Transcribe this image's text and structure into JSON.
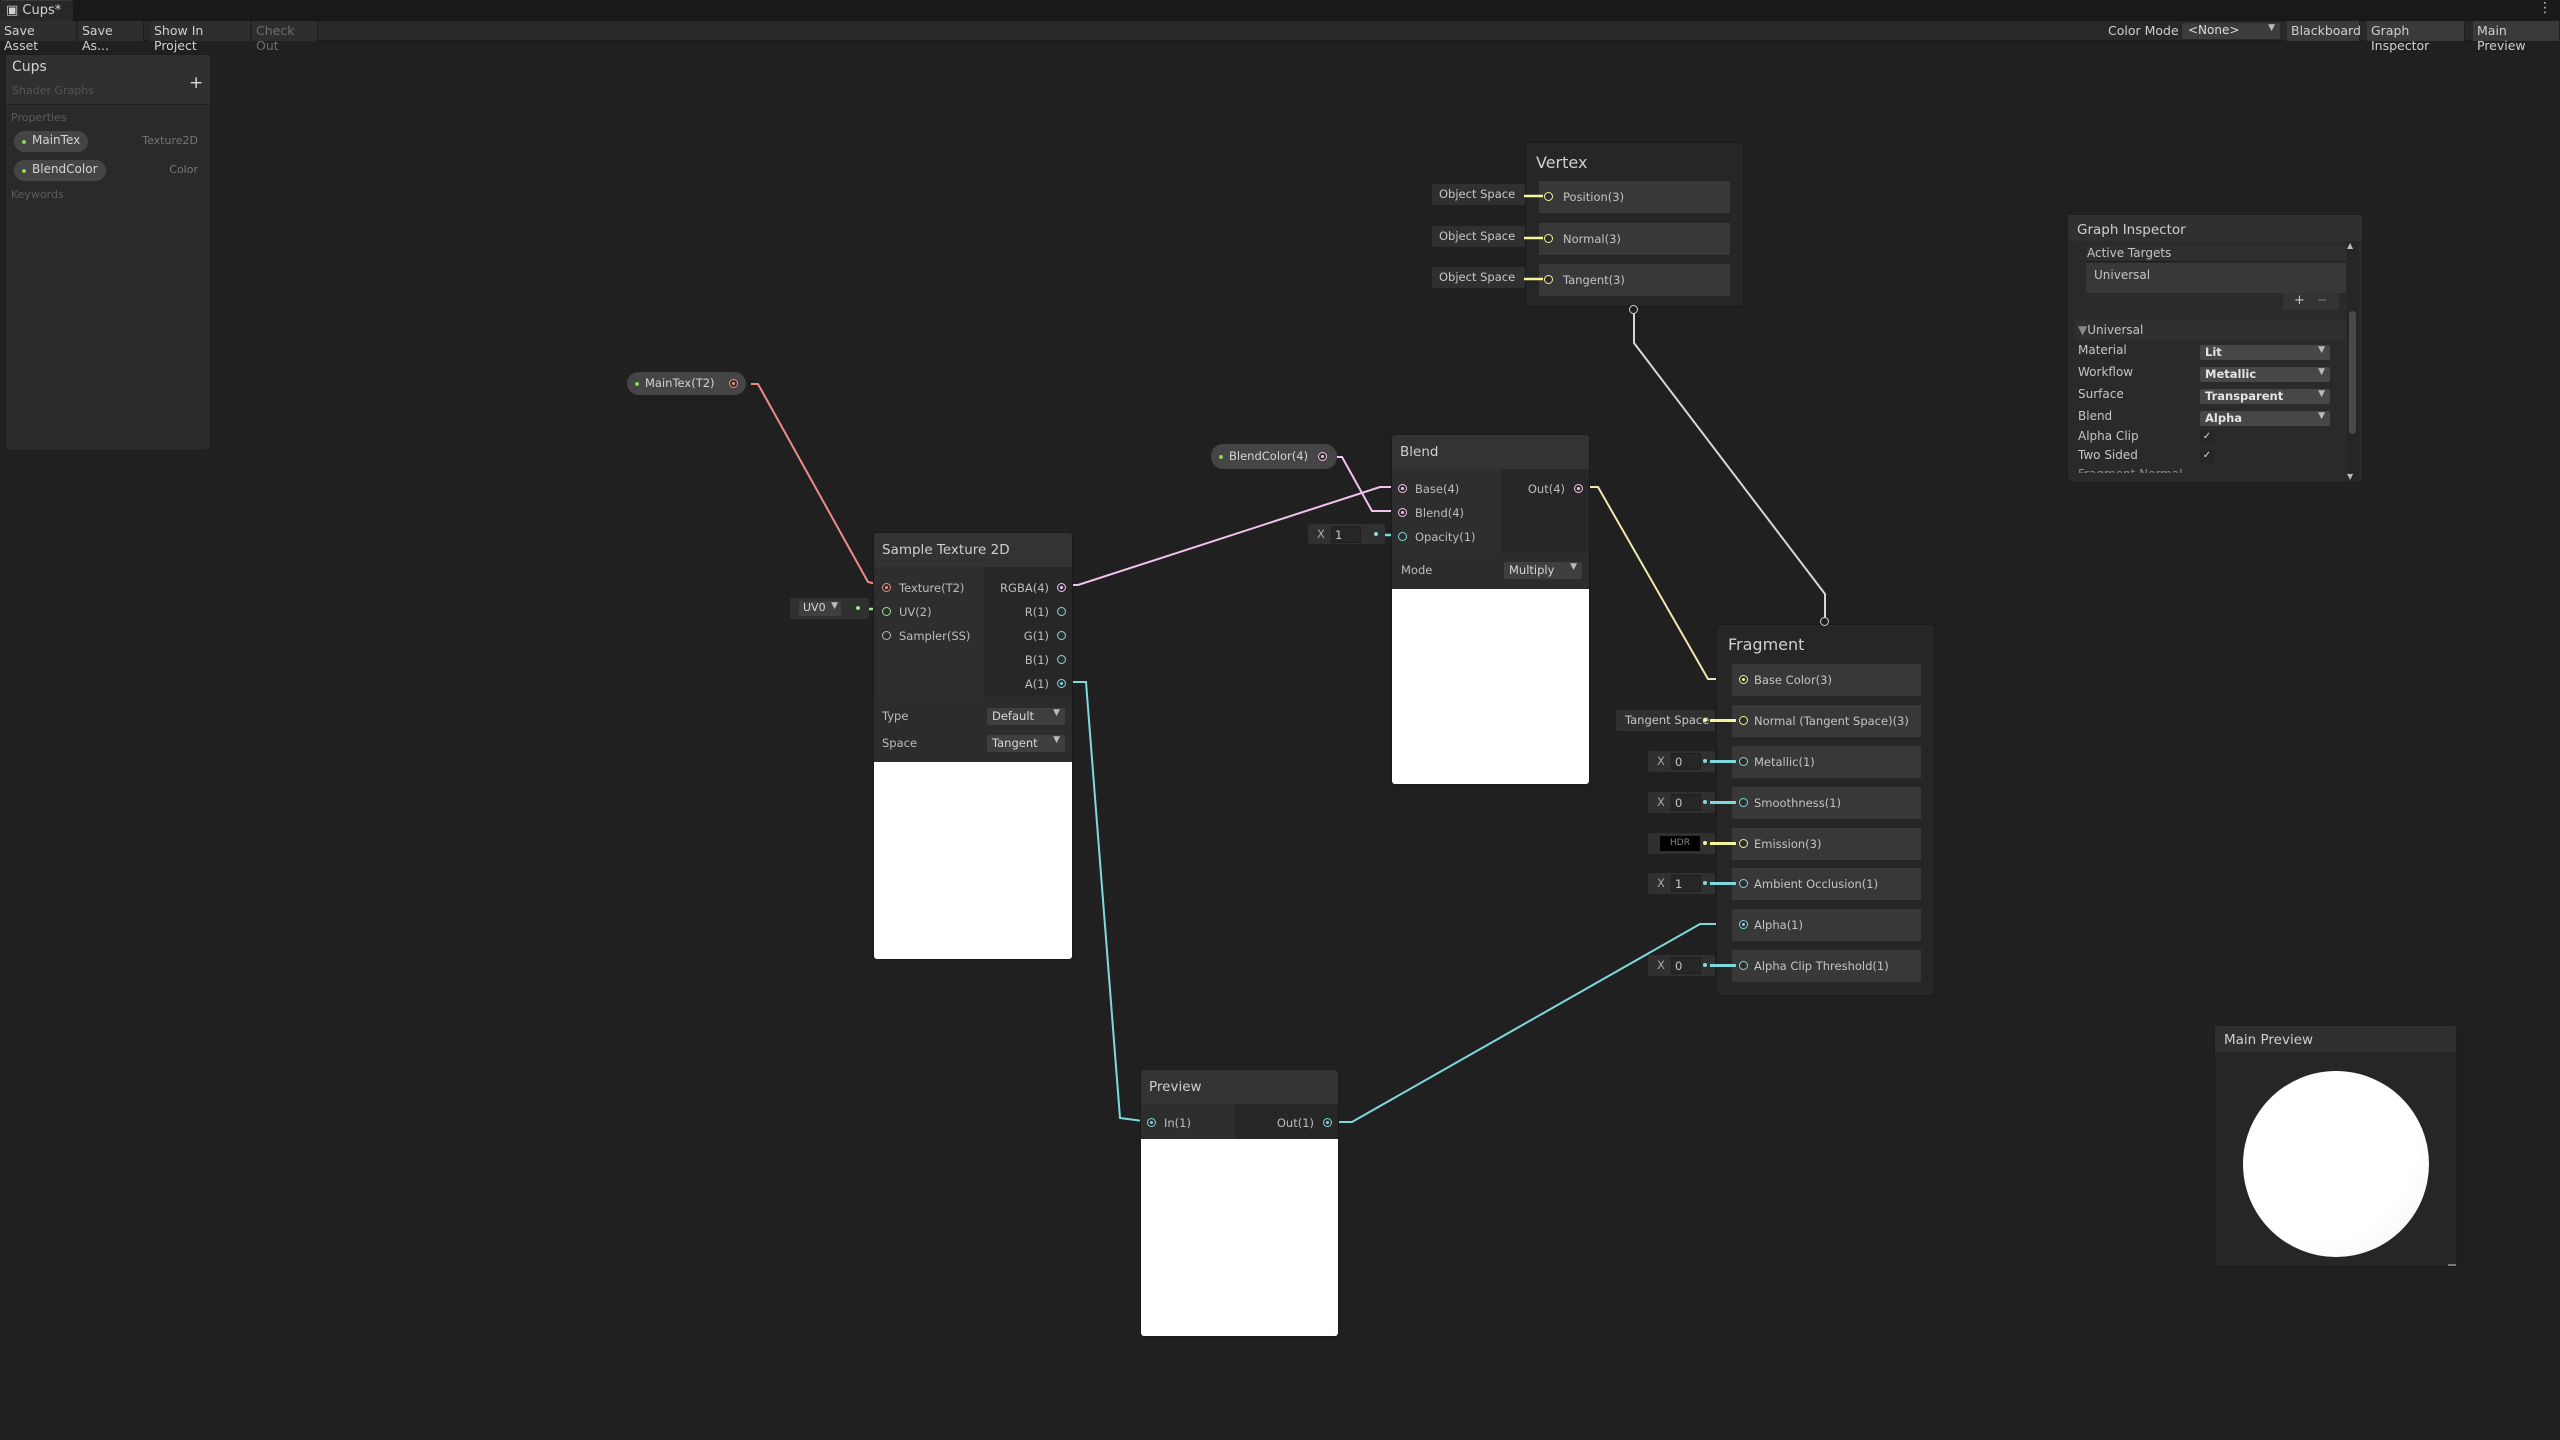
{
  "window": {
    "tab_title": "Cups*",
    "tab_icon": "shader-graph-icon",
    "menu_icon": "kebab-icon"
  },
  "toolbar": {
    "save_asset": "Save Asset",
    "save_as": "Save As...",
    "show_in_project": "Show In Project",
    "check_out": "Check Out",
    "color_mode_label": "Color Mode",
    "color_mode_value": "<None>",
    "blackboard": "Blackboard",
    "graph_inspector": "Graph Inspector",
    "main_preview": "Main Preview"
  },
  "blackboard": {
    "title": "Cups",
    "subtitle": "Shader Graphs",
    "add_icon": "+",
    "properties_label": "Properties",
    "properties": [
      {
        "name": "MainTex",
        "type": "Texture2D"
      },
      {
        "name": "BlendColor",
        "type": "Color"
      }
    ],
    "keywords_label": "Keywords"
  },
  "graph_inspector": {
    "title": "Graph Inspector",
    "active_targets_label": "Active Targets",
    "targets": [
      "Universal"
    ],
    "add": "+",
    "remove": "−",
    "section": "Universal",
    "settings": [
      {
        "label": "Material",
        "value": "Lit"
      },
      {
        "label": "Workflow",
        "value": "Metallic"
      },
      {
        "label": "Surface",
        "value": "Transparent"
      },
      {
        "label": "Blend",
        "value": "Alpha"
      }
    ],
    "checks": [
      {
        "label": "Alpha Clip",
        "checked": true
      },
      {
        "label": "Two Sided",
        "checked": true
      }
    ],
    "cut_label": "Fragment Normal"
  },
  "nodes": {
    "maintex": {
      "label": "MainTex(T2)"
    },
    "blendcolor": {
      "label": "BlendColor(4)"
    },
    "vertex": {
      "title": "Vertex",
      "inputs": [
        {
          "label": "Position(3)",
          "default": "Object Space"
        },
        {
          "label": "Normal(3)",
          "default": "Object Space"
        },
        {
          "label": "Tangent(3)",
          "default": "Object Space"
        }
      ]
    },
    "sample_texture": {
      "title": "Sample Texture 2D",
      "inputs": [
        "Texture(T2)",
        "UV(2)",
        "Sampler(SS)"
      ],
      "outputs": [
        "RGBA(4)",
        "R(1)",
        "G(1)",
        "B(1)",
        "A(1)"
      ],
      "uv_default": "UV0",
      "type_label": "Type",
      "type_value": "Default",
      "space_label": "Space",
      "space_value": "Tangent"
    },
    "blend": {
      "title": "Blend",
      "inputs": [
        "Base(4)",
        "Blend(4)",
        "Opacity(1)"
      ],
      "outputs": [
        "Out(4)"
      ],
      "opacity_axis": "X",
      "opacity_value": "1",
      "mode_label": "Mode",
      "mode_value": "Multiply"
    },
    "fragment": {
      "title": "Fragment",
      "inputs": [
        {
          "label": "Base Color(3)"
        },
        {
          "label": "Normal (Tangent Space)(3)",
          "default": "Tangent Space"
        },
        {
          "label": "Metallic(1)",
          "axis": "X",
          "value": "0"
        },
        {
          "label": "Smoothness(1)",
          "axis": "X",
          "value": "0"
        },
        {
          "label": "Emission(3)",
          "default": "HDR"
        },
        {
          "label": "Ambient Occlusion(1)",
          "axis": "X",
          "value": "1"
        },
        {
          "label": "Alpha(1)"
        },
        {
          "label": "Alpha Clip Threshold(1)",
          "axis": "X",
          "value": "0"
        }
      ]
    },
    "preview": {
      "title": "Preview",
      "inputs": [
        "In(1)"
      ],
      "outputs": [
        "Out(1)"
      ]
    }
  },
  "main_preview": {
    "title": "Main Preview"
  },
  "colors": {
    "texture": "#f08a8a",
    "vector4": "#f4c1ee",
    "vector3": "#f2f59a",
    "vector2": "#98e68e",
    "vector1": "#7fd8dc",
    "background": "#202020"
  }
}
